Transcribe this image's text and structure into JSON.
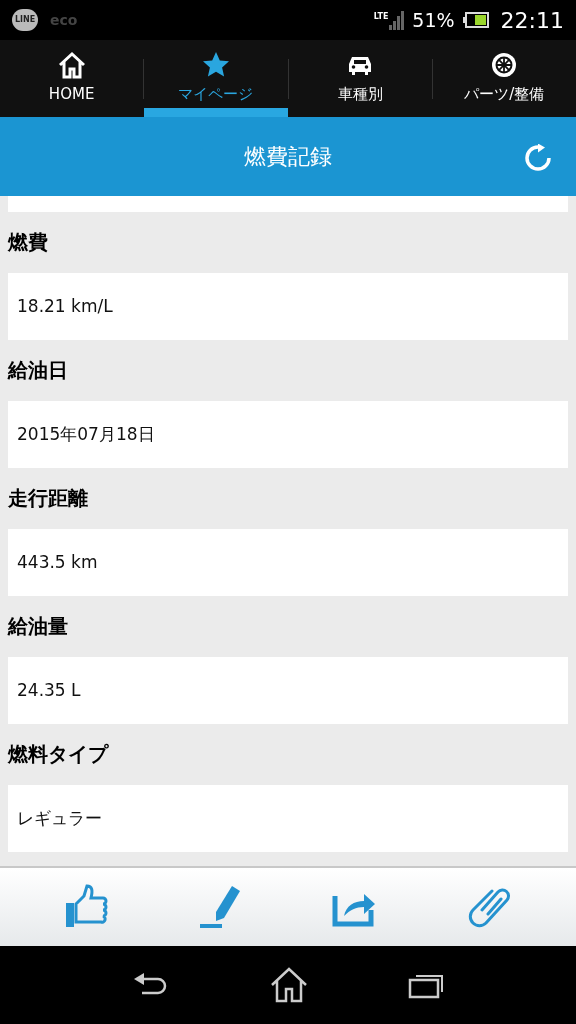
{
  "status_bar": {
    "notifications": [
      "LINE",
      "eco"
    ],
    "network": "LTE",
    "battery": "51%",
    "time": "22:11"
  },
  "tabs": [
    {
      "label": "HOME",
      "kind": "home",
      "selected": false
    },
    {
      "label": "マイページ",
      "kind": "star",
      "selected": true
    },
    {
      "label": "車種別",
      "kind": "car",
      "selected": false
    },
    {
      "label": "パーツ/整備",
      "kind": "wheel",
      "selected": false
    }
  ],
  "header": {
    "title": "燃費記録"
  },
  "fields": [
    {
      "label": "燃費",
      "value": "18.21 km/L"
    },
    {
      "label": "給油日",
      "value": "2015年07月18日"
    },
    {
      "label": "走行距離",
      "value": "443.5 km"
    },
    {
      "label": "給油量",
      "value": "24.35 L"
    },
    {
      "label": "燃料タイプ",
      "value": "レギュラー"
    }
  ],
  "toolbar": [
    {
      "kind": "like"
    },
    {
      "kind": "edit"
    },
    {
      "kind": "share"
    },
    {
      "kind": "attach"
    }
  ]
}
